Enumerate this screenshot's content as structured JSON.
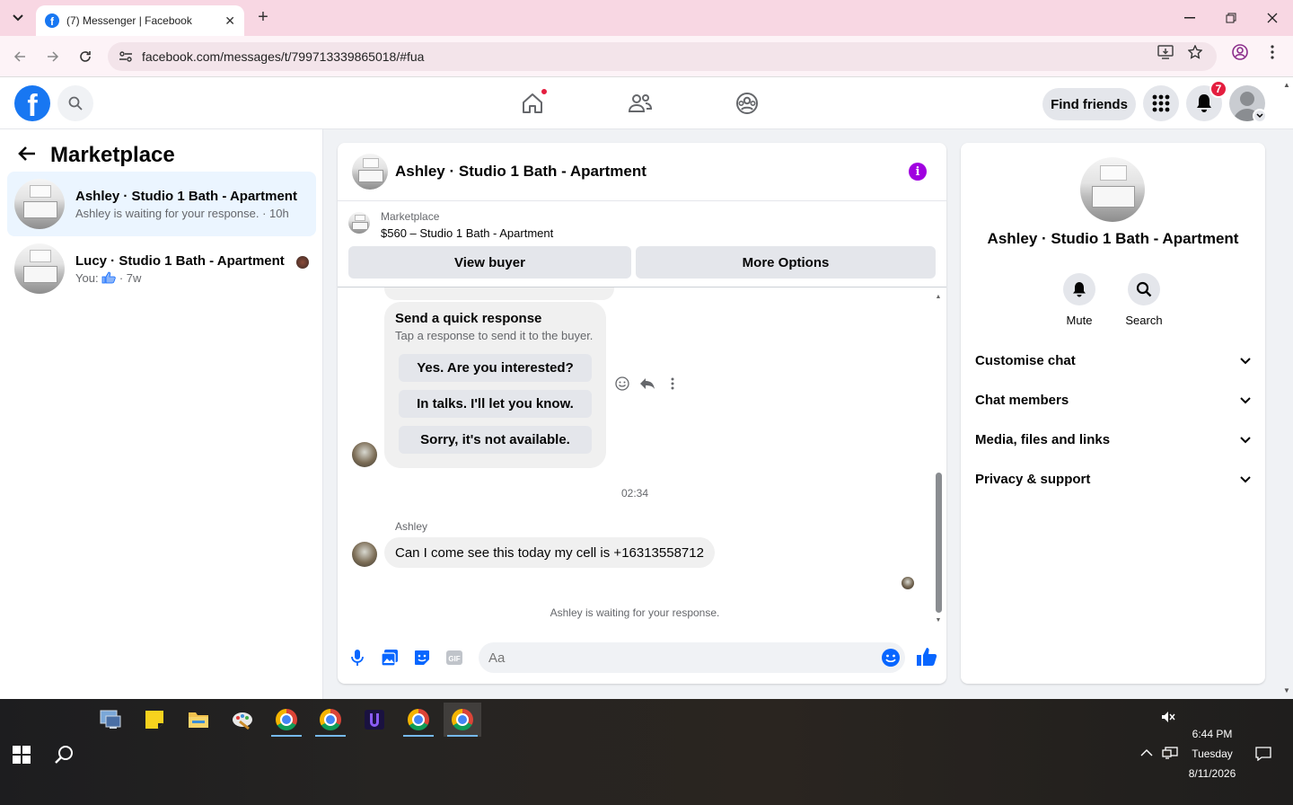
{
  "browser": {
    "tab_title": "(7) Messenger | Facebook",
    "url": "facebook.com/messages/t/799713339865018/#fua"
  },
  "fbnav": {
    "find_friends_label": "Find friends",
    "notifications_count": "7"
  },
  "sidebar": {
    "title": "Marketplace",
    "conversations": [
      {
        "name": "Ashley · Studio 1 Bath - Apartment",
        "preview": "Ashley is waiting for your response. · 10h",
        "active": true
      },
      {
        "name": "Lucy · Studio 1 Bath - Apartment",
        "preview_prefix": "You:",
        "preview_suffix": "· 7w",
        "active": false
      }
    ]
  },
  "chat": {
    "title": "Ashley · Studio 1 Bath - Apartment",
    "marketplace_label": "Marketplace",
    "listing": "$560 – Studio 1 Bath - Apartment",
    "view_buyer_label": "View buyer",
    "more_options_label": "More Options",
    "quick_response": {
      "heading": "Send a quick response",
      "subheading": "Tap a response to send it to the buyer.",
      "options": [
        "Yes. Are you interested?",
        "In talks. I'll let you know.",
        "Sorry, it's not available."
      ]
    },
    "timestamp": "02:34",
    "sender": "Ashley",
    "message": "Can I come see this today my cell is +16313558712",
    "status": "Ashley is waiting for your response.",
    "composer_placeholder": "Aa"
  },
  "info_panel": {
    "name": "Ashley · Studio 1 Bath - Apartment",
    "actions": [
      "Mute",
      "Search"
    ],
    "sections": [
      "Customise chat",
      "Chat members",
      "Media, files and links",
      "Privacy & support"
    ]
  },
  "taskbar": {
    "time": "6:44 PM",
    "day": "Tuesday",
    "date": "8/11/2026"
  },
  "colors": {
    "facebook_blue": "#1877f2",
    "messenger_blue": "#0866ff",
    "info_purple": "#a000e0",
    "badge_red": "#e41e3f",
    "active_row": "#ebf5ff",
    "tab_strip": "#f8d7e3"
  }
}
